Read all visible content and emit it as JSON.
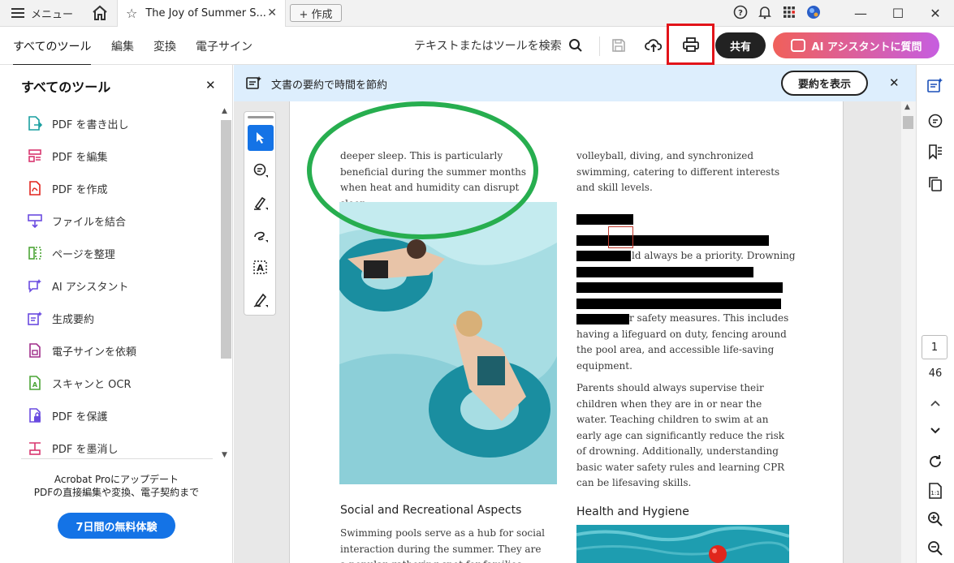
{
  "titlebar": {
    "menu_label": "メニュー",
    "doc_tab_title": "The Joy of Summer S...",
    "create_label": "+ 作成"
  },
  "toolbar": {
    "tabs": [
      "すべてのツール",
      "編集",
      "変換",
      "電子サイン"
    ],
    "search_label": "テキストまたはツールを検索",
    "share_label": "共有",
    "ai_label": "AI アシスタントに質問"
  },
  "left_panel": {
    "title": "すべてのツール",
    "tools": [
      {
        "label": "PDF を書き出し",
        "icon": "export-pdf-icon",
        "color": "#1a9fa0"
      },
      {
        "label": "PDF を編集",
        "icon": "edit-pdf-icon",
        "color": "#d9366f"
      },
      {
        "label": "PDF を作成",
        "icon": "create-pdf-icon",
        "color": "#e2241d"
      },
      {
        "label": "ファイルを結合",
        "icon": "combine-files-icon",
        "color": "#6a4be0"
      },
      {
        "label": "ページを整理",
        "icon": "organize-pages-icon",
        "color": "#4ca537"
      },
      {
        "label": "AI アシスタント",
        "icon": "ai-assistant-icon",
        "color": "#6a4be0"
      },
      {
        "label": "生成要約",
        "icon": "generative-summary-icon",
        "color": "#6a4be0"
      },
      {
        "label": "電子サインを依頼",
        "icon": "request-esign-icon",
        "color": "#a02e8a"
      },
      {
        "label": "スキャンと OCR",
        "icon": "scan-ocr-icon",
        "color": "#4ca537"
      },
      {
        "label": "PDF を保護",
        "icon": "protect-pdf-icon",
        "color": "#6a4be0"
      },
      {
        "label": "PDF を墨消し",
        "icon": "redact-pdf-icon",
        "color": "#d9366f"
      }
    ],
    "upgrade_line1": "Acrobat Proにアップデート",
    "upgrade_line2": "PDFの直接編集や変換、電子契約まで",
    "trial_label": "7日間の無料体験"
  },
  "summary_bar": {
    "text": "文書の要約で時間を節約",
    "button": "要約を表示"
  },
  "document": {
    "left_col_top": "deeper sleep. This is particularly beneficial during the summer months when heat and humidity can disrupt sleep.",
    "left_heading": "Social and Recreational Aspects",
    "left_col_bottom": "Swimming pools serve as a hub for social interaction during the summer. They are a popular gathering spot for families, friends,",
    "right_col_top": "volleyball, diving, and synchronized swimming, catering to different interests and skill levels.",
    "redacted_frag1": "ld always be a priority. Drowning",
    "redacted_frag2": "r safety measures. This includes having a lifeguard on duty, fencing around the pool area, and accessible life-saving equipment.",
    "right_para2": "Parents should always supervise their children when they are in or near the water. Teaching children to swim at an early age can significantly reduce the risk of drowning. Additionally, understanding basic water safety rules and learning CPR can be lifesaving skills.",
    "right_heading": "Health and Hygiene"
  },
  "page_nav": {
    "current": "1",
    "total": "46"
  }
}
